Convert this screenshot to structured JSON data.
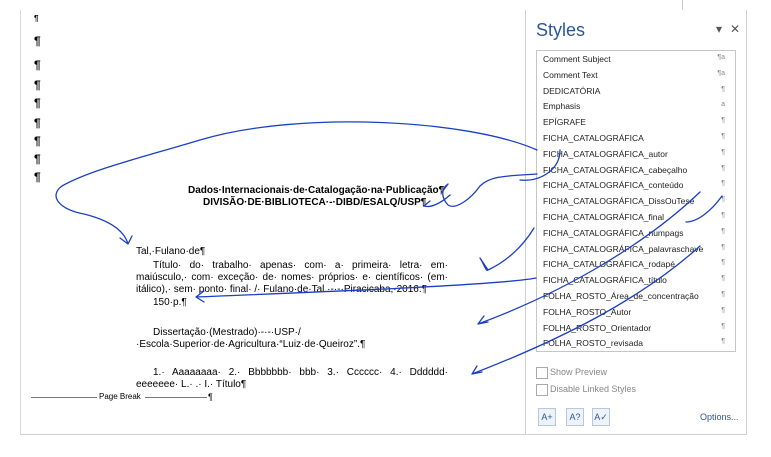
{
  "document": {
    "pilcrow": "¶",
    "heading_line1": "Dados·Internacionais·de·Catalogação·na·Publicação¶",
    "heading_line2": "DIVISÃO·DE·BIBLIOTECA·-·DIBD/ESALQ/USP¶",
    "author": "Tal,·Fulano·de¶",
    "title_para": "Título· do· trabalho· apenas· com· a· primeira· letra· em· maiúsculo,· com· exceção· de· nomes· próprios· e· científicos· (em· itálico),· sem· ponto· final· /· Fulano·de·Tal.·-·-·Piracicaba,·2016.¶",
    "pages": "150·p.¶",
    "dissertation": "Dissertação·(Mestrado)·-·-·USP·/·Escola·Superior·de·Agricultura·“Luiz·de·Queiroz”.¶",
    "subjects": "1.· Aaaaaaaa· 2.· Bbbbbbb· bbb· 3.· Cccccc· 4.· Dddddd· eeeeeee· L.· .· I.· Título¶",
    "page_break": "Page Break"
  },
  "styles_pane": {
    "title": "Styles",
    "menu_icon": "▾",
    "close_icon": "✕",
    "items": [
      {
        "name": "Comment Subject",
        "icon": "¶a"
      },
      {
        "name": "Comment Text",
        "icon": "¶a"
      },
      {
        "name": "DEDICATÓRIA",
        "icon": "¶"
      },
      {
        "name": "Emphasis",
        "icon": "a"
      },
      {
        "name": "EPÍGRAFE",
        "icon": "¶"
      },
      {
        "name": "FICHA_CATALOGRÁFICA",
        "icon": "¶"
      },
      {
        "name": "FICHA_CATALOGRÁFICA_autor",
        "icon": "¶"
      },
      {
        "name": "FICHA_CATALOGRÁFICA_cabeçalho",
        "icon": "¶"
      },
      {
        "name": "FICHA_CATALOGRÁFICA_conteúdo",
        "icon": "¶"
      },
      {
        "name": "FICHA_CATALOGRÁFICA_DissOuTese",
        "icon": "¶"
      },
      {
        "name": "FICHA_CATALOGRÁFICA_final",
        "icon": "¶"
      },
      {
        "name": "FICHA_CATALOGRÁFICA_numpags",
        "icon": "¶"
      },
      {
        "name": "FICHA_CATALOGRÁFICA_palavraschave",
        "icon": "¶"
      },
      {
        "name": "FICHA_CATALOGRÁFICA_rodapé",
        "icon": "¶"
      },
      {
        "name": "FICHA_CATALOGRÁFICA_título",
        "icon": "¶"
      },
      {
        "name": "FOLHA_ROSTO_Área_de_concentração",
        "icon": "¶"
      },
      {
        "name": "FOLHA_ROSTO_Autor",
        "icon": "¶"
      },
      {
        "name": "FOLHA_ROSTO_Orientador",
        "icon": "¶"
      },
      {
        "name": "FOLHA_ROSTO_revisada",
        "icon": "¶"
      }
    ],
    "show_preview": "Show Preview",
    "disable_linked": "Disable Linked Styles",
    "options": "Options...",
    "new_style_icon": "new-style-icon",
    "style_inspector_icon": "style-inspector-icon",
    "manage_styles_icon": "manage-styles-icon"
  },
  "colors": {
    "accent": "#2b579a",
    "ink": "#1a3fc4"
  }
}
